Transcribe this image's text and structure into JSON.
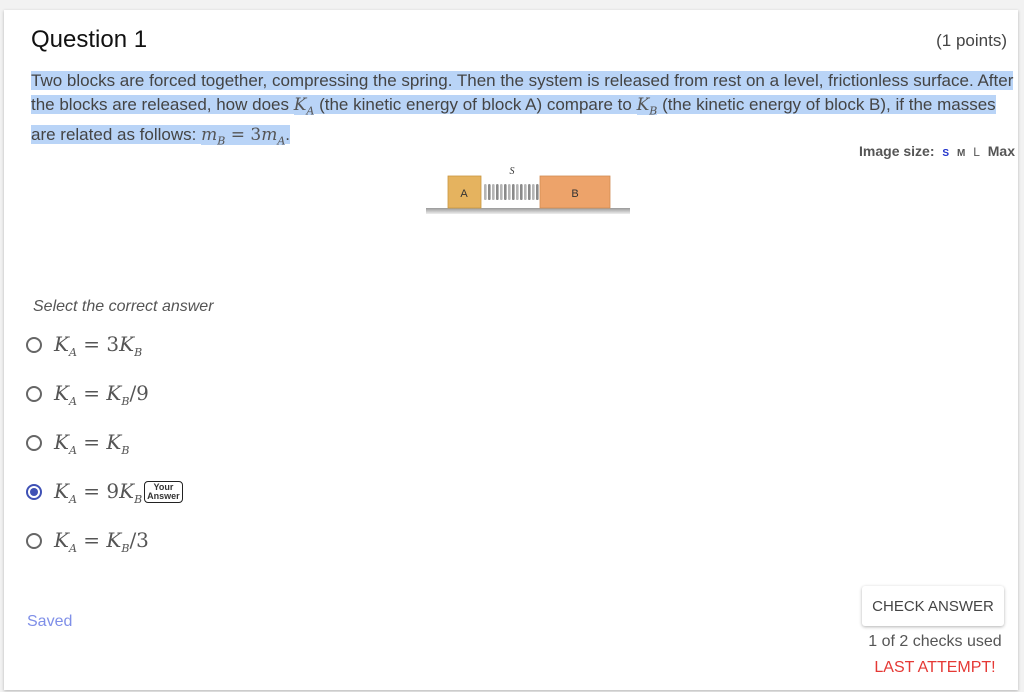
{
  "question": {
    "title": "Question 1",
    "points": "(1 points)",
    "prompt": {
      "part1": "Two blocks are forced together, compressing the spring. Then the system is released from rest on a level, frictionless surface. After the blocks are released, how does ",
      "ka_var": "K",
      "ka_sub": "A",
      "part2": " (the kinetic energy of block A) compare to ",
      "kb_var": "K",
      "kb_sub": "B",
      "part3": " (the kinetic energy of block B), if the masses are related as follows: ",
      "mass_relation": {
        "lhs_var": "m",
        "lhs_sub": "B",
        "eq": " = ",
        "coef": "3",
        "rhs_var": "m",
        "rhs_sub": "A"
      },
      "end": "."
    }
  },
  "image_size": {
    "label": "Image size:",
    "options": [
      "S",
      "M",
      "L",
      "Max"
    ],
    "selected": "S"
  },
  "figure": {
    "block_a_label": "A",
    "block_b_label": "B",
    "spring_label": "S",
    "colors": {
      "block_a": "#e5b35f",
      "block_b": "#eda36a",
      "floor": "#999999"
    }
  },
  "select_label": "Select the correct answer",
  "options": [
    {
      "lhs": "K",
      "lhs_sub": "A",
      "eq": " = ",
      "pre": "3",
      "rhs": "K",
      "rhs_sub": "B",
      "post": "",
      "selected": false
    },
    {
      "lhs": "K",
      "lhs_sub": "A",
      "eq": " = ",
      "pre": "",
      "rhs": "K",
      "rhs_sub": "B",
      "post": "/9",
      "selected": false
    },
    {
      "lhs": "K",
      "lhs_sub": "A",
      "eq": " = ",
      "pre": "",
      "rhs": "K",
      "rhs_sub": "B",
      "post": "",
      "selected": false
    },
    {
      "lhs": "K",
      "lhs_sub": "A",
      "eq": " = ",
      "pre": "9",
      "rhs": "K",
      "rhs_sub": "B",
      "post": "",
      "selected": true,
      "badge": [
        "Your",
        "Answer"
      ]
    },
    {
      "lhs": "K",
      "lhs_sub": "A",
      "eq": " = ",
      "pre": "",
      "rhs": "K",
      "rhs_sub": "B",
      "post": "/3",
      "selected": false
    }
  ],
  "status": {
    "saved": "Saved",
    "check_button": "CHECK ANSWER",
    "checks_used": "1 of 2 checks used",
    "last_attempt": "LAST ATTEMPT!"
  },
  "colors": {
    "accent": "#3f51b5",
    "highlight": "#b9d4f7",
    "saved": "#7f8fe8",
    "warning": "#e53935"
  }
}
